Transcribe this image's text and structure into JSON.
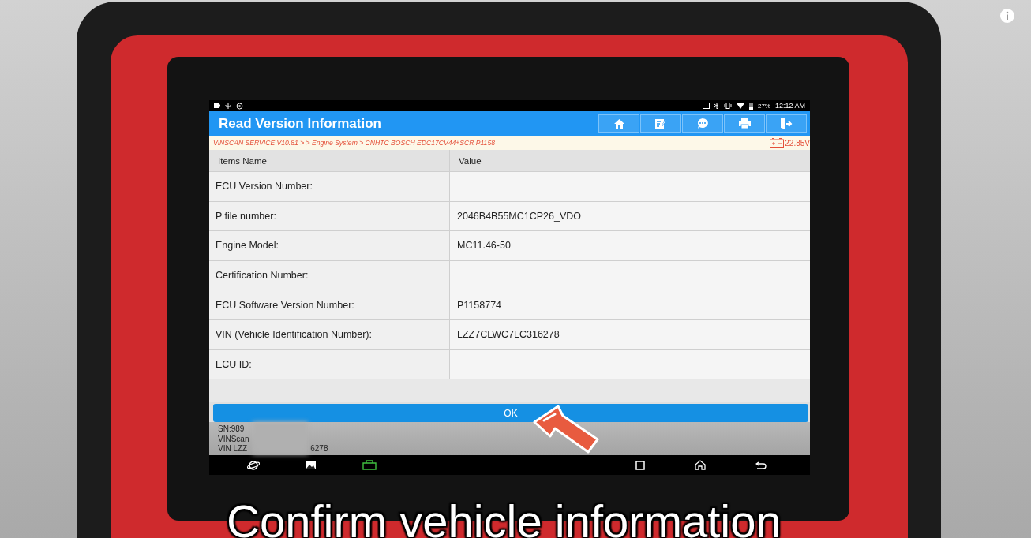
{
  "status_bar": {
    "battery": "27%",
    "time": "12:12 AM"
  },
  "header": {
    "title": "Read Version Information",
    "buttons": [
      {
        "kind": "home"
      },
      {
        "kind": "edit"
      },
      {
        "kind": "chat"
      },
      {
        "kind": "print"
      },
      {
        "kind": "exit"
      }
    ]
  },
  "breadcrumb": {
    "path": "VINSCAN SERVICE V10.81 >  > Engine System > CNHTC BOSCH EDC17CV44+SCR P1158",
    "voltage": "22.85V"
  },
  "table": {
    "columns": [
      "Items Name",
      "Value"
    ],
    "rows": [
      {
        "name": "ECU Version Number:",
        "value": ""
      },
      {
        "name": "P file number:",
        "value": "2046B4B55MC1CP26_VDO"
      },
      {
        "name": "Engine Model:",
        "value": "MC11.46-50"
      },
      {
        "name": "Certification Number:",
        "value": ""
      },
      {
        "name": "ECU Software Version Number:",
        "value": "P1158774"
      },
      {
        "name": "VIN (Vehicle Identification Number):",
        "value": "LZZ7CLWC7LC316278"
      },
      {
        "name": "ECU ID:",
        "value": ""
      }
    ]
  },
  "ok_button": "OK",
  "device_info": [
    {
      "text": "SN:989"
    },
    {
      "text": "VINScan"
    },
    {
      "text": "VIN LZZ",
      "tail": "6278"
    }
  ],
  "caption": "Confirm vehicle information"
}
